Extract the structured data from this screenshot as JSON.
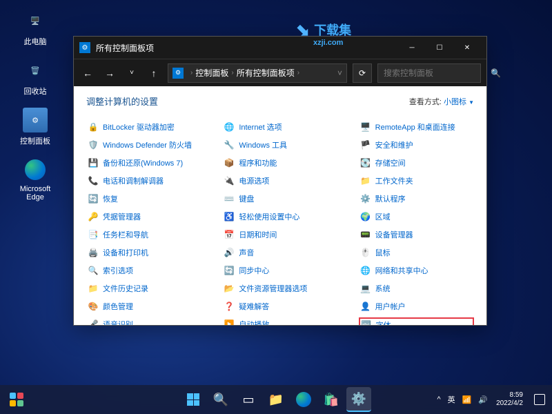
{
  "desktop": {
    "icons": [
      {
        "name": "this-pc",
        "label": "此电脑"
      },
      {
        "name": "recycle-bin",
        "label": "回收站"
      },
      {
        "name": "control-panel",
        "label": "控制面板"
      },
      {
        "name": "edge",
        "label": "Microsoft Edge"
      }
    ]
  },
  "watermark": {
    "main": "下载集",
    "sub": "xzji.com"
  },
  "window": {
    "title": "所有控制面板项",
    "breadcrumb": [
      "控制面板",
      "所有控制面板项"
    ],
    "search_placeholder": "搜索控制面板",
    "content_title": "调整计算机的设置",
    "view_label": "查看方式:",
    "view_value": "小图标",
    "columns": [
      [
        {
          "icon": "🔒",
          "label": "BitLocker 驱动器加密"
        },
        {
          "icon": "🛡️",
          "label": "Windows Defender 防火墙"
        },
        {
          "icon": "💾",
          "label": "备份和还原(Windows 7)"
        },
        {
          "icon": "📞",
          "label": "电话和调制解调器"
        },
        {
          "icon": "🔄",
          "label": "恢复"
        },
        {
          "icon": "🔑",
          "label": "凭据管理器"
        },
        {
          "icon": "📑",
          "label": "任务栏和导航"
        },
        {
          "icon": "🖨️",
          "label": "设备和打印机"
        },
        {
          "icon": "🔍",
          "label": "索引选项"
        },
        {
          "icon": "📁",
          "label": "文件历史记录"
        },
        {
          "icon": "🎨",
          "label": "颜色管理"
        },
        {
          "icon": "🎤",
          "label": "语音识别"
        }
      ],
      [
        {
          "icon": "🌐",
          "label": "Internet 选项"
        },
        {
          "icon": "🔧",
          "label": "Windows 工具"
        },
        {
          "icon": "📦",
          "label": "程序和功能"
        },
        {
          "icon": "🔌",
          "label": "电源选项"
        },
        {
          "icon": "⌨️",
          "label": "键盘"
        },
        {
          "icon": "♿",
          "label": "轻松使用设置中心"
        },
        {
          "icon": "📅",
          "label": "日期和时间"
        },
        {
          "icon": "🔊",
          "label": "声音"
        },
        {
          "icon": "🔄",
          "label": "同步中心"
        },
        {
          "icon": "📂",
          "label": "文件资源管理器选项"
        },
        {
          "icon": "❓",
          "label": "疑难解答"
        },
        {
          "icon": "▶️",
          "label": "自动播放"
        }
      ],
      [
        {
          "icon": "🖥️",
          "label": "RemoteApp 和桌面连接"
        },
        {
          "icon": "🏴",
          "label": "安全和维护"
        },
        {
          "icon": "💽",
          "label": "存储空间"
        },
        {
          "icon": "📁",
          "label": "工作文件夹"
        },
        {
          "icon": "⚙️",
          "label": "默认程序"
        },
        {
          "icon": "🌍",
          "label": "区域"
        },
        {
          "icon": "📟",
          "label": "设备管理器"
        },
        {
          "icon": "🖱️",
          "label": "鼠标"
        },
        {
          "icon": "🌐",
          "label": "网络和共享中心"
        },
        {
          "icon": "💻",
          "label": "系统"
        },
        {
          "icon": "👤",
          "label": "用户帐户"
        },
        {
          "icon": "🔤",
          "label": "字体",
          "highlighted": true
        }
      ]
    ]
  },
  "taskbar": {
    "tray": {
      "chevron": "^",
      "ime": "英",
      "wifi": "📶",
      "vol": "🔊"
    },
    "time": "8:59",
    "date": "2022/4/2"
  }
}
